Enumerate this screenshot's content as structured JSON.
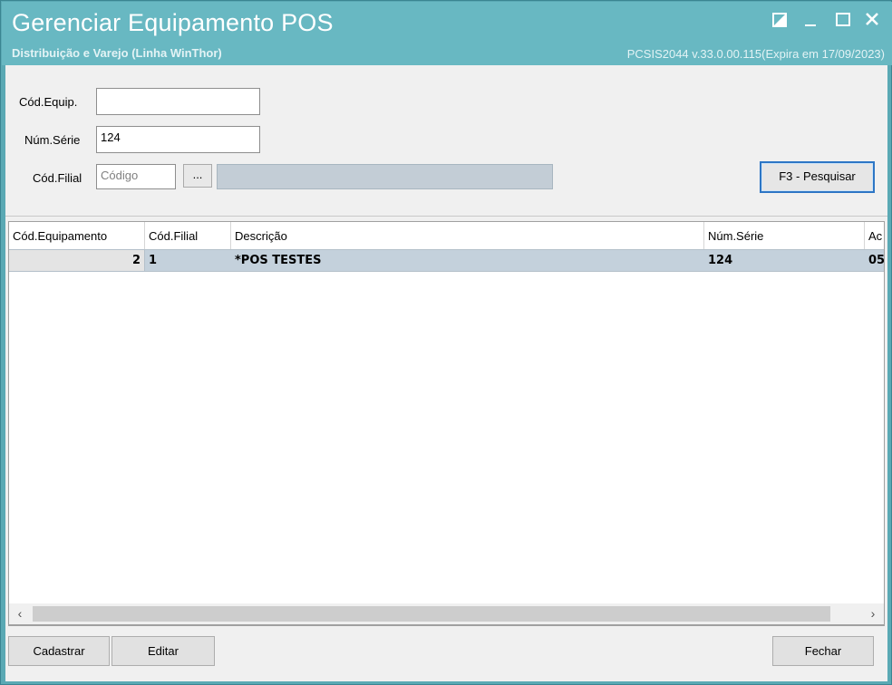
{
  "window": {
    "title": "Gerenciar Equipamento POS",
    "subtitle": "Distribuição e Varejo (Linha WinThor)",
    "version": "PCSIS2044  v.33.0.00.115(Expira em 17/09/2023)"
  },
  "filters": {
    "cod_equip_label": "Cód.Equip.",
    "cod_equip_value": "",
    "num_serie_label": "Núm.Série",
    "num_serie_value": "124",
    "cod_filial_label": "Cód.Filial",
    "cod_filial_placeholder": "Código",
    "lookup_label": "...",
    "search_button": "F3 - Pesquisar"
  },
  "grid": {
    "columns": [
      "Cód.Equipamento",
      "Cód.Filial",
      "Descrição",
      "Núm.Série",
      "Ac"
    ],
    "rows": [
      {
        "cod_equipamento": "2",
        "cod_filial": "1",
        "descricao": "*POS TESTES",
        "num_serie": "124",
        "extra": "05"
      }
    ]
  },
  "footer": {
    "cadastrar": "Cadastrar",
    "editar": "Editar",
    "fechar": "Fechar"
  }
}
